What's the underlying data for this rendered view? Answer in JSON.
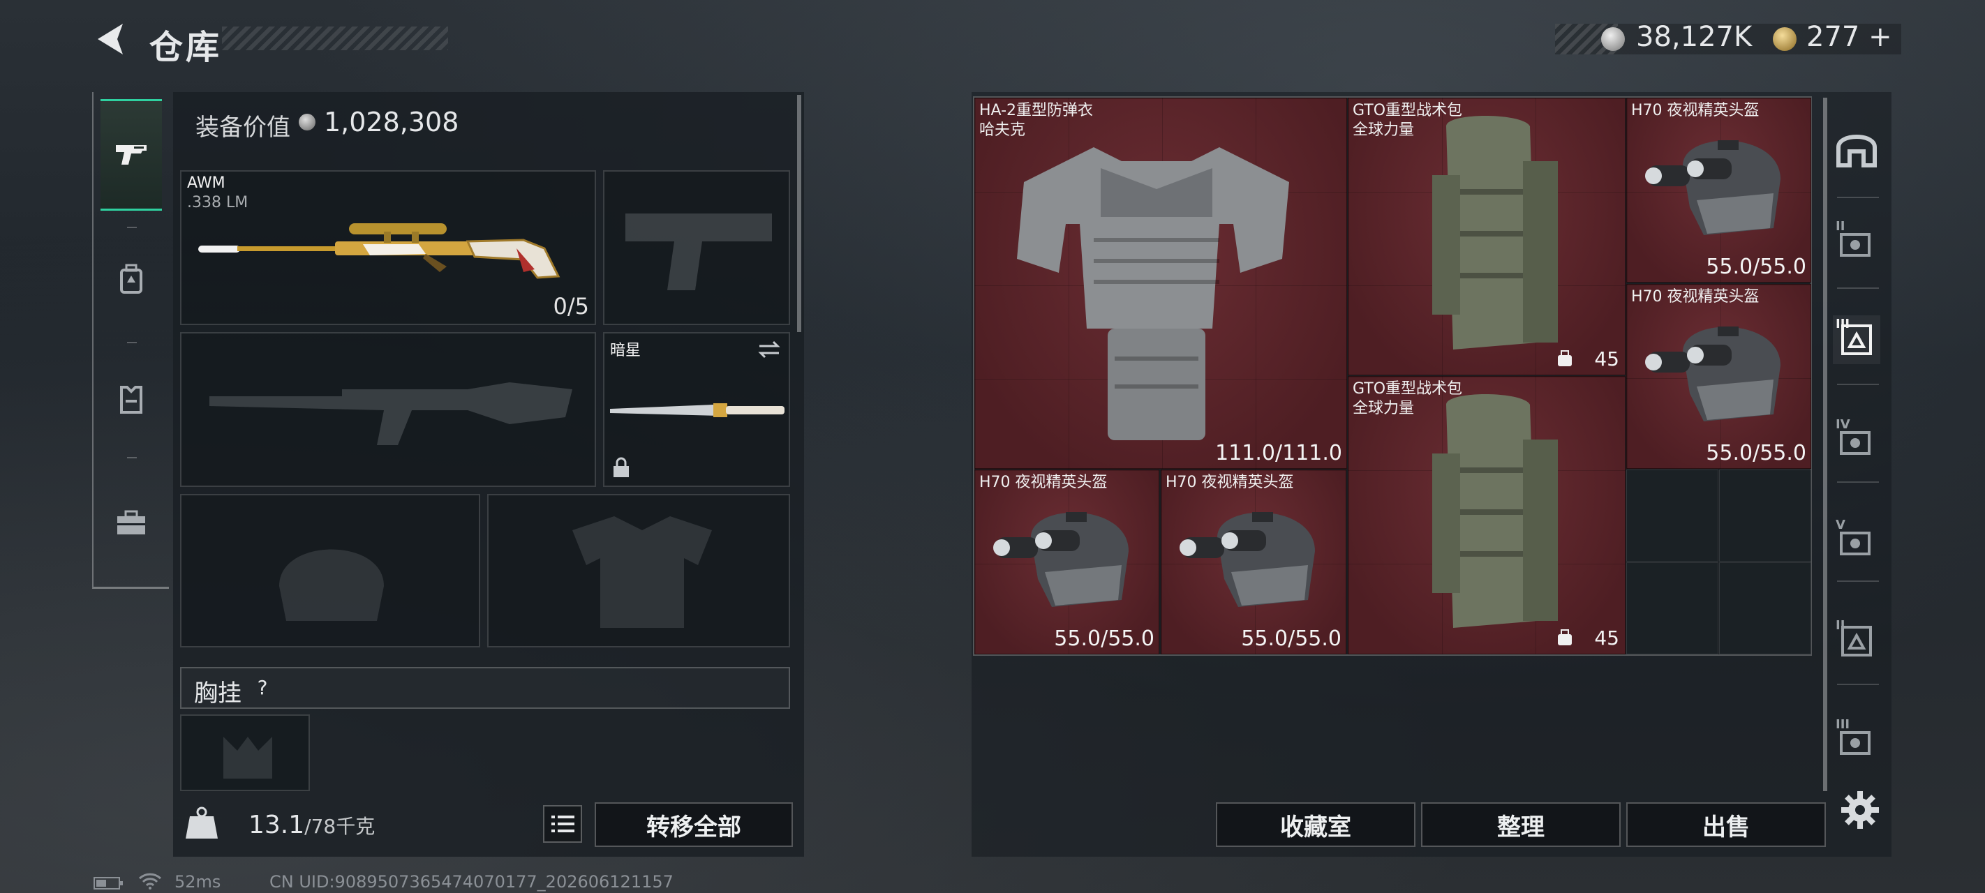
{
  "header": {
    "title": "仓库",
    "currency_1": "38,127K",
    "currency_2": "277",
    "currency_2_add": "+"
  },
  "equipment": {
    "value_label": "装备价值",
    "value": "1,028,308",
    "primary": {
      "name": "AWM",
      "ammo_type": ".338 LM",
      "ammo_count": "0/5"
    },
    "melee": {
      "name": "暗星"
    },
    "chest_rig_label": "胸挂",
    "chest_rig_help": "?"
  },
  "footer_left": {
    "weight_current": "13.1",
    "weight_max": "/78千克",
    "transfer_all": "转移全部"
  },
  "storage": {
    "items": [
      {
        "name": "HA-2重型防弹衣",
        "sub": "哈夫克",
        "value": "111.0/111.0"
      },
      {
        "name": "GTO重型战术包",
        "sub": "全球力量",
        "capacity": "45"
      },
      {
        "name": "H70 夜视精英头盔",
        "value": "55.0/55.0"
      },
      {
        "name": "H70 夜视精英头盔",
        "value": "55.0/55.0"
      },
      {
        "name": "GTO重型战术包",
        "sub": "全球力量",
        "capacity": "45"
      },
      {
        "name": "H70 夜视精英头盔",
        "value": "55.0/55.0"
      },
      {
        "name": "H70 夜视精英头盔",
        "value": "55.0/55.0"
      }
    ],
    "buttons": {
      "collection": "收藏室",
      "sort": "整理",
      "sell": "出售"
    }
  },
  "side_tabs": [
    "I",
    "II",
    "III",
    "IV",
    "V",
    "II",
    "III"
  ],
  "status": {
    "ping": "52ms",
    "uid": "CN UID:9089507365474070177_202606121157"
  },
  "icons": [
    "back-icon",
    "silver-coin-icon",
    "gold-coin-icon",
    "pistol-icon",
    "backpack-icon",
    "vest-icon",
    "toolbox-icon",
    "lock-icon",
    "swap-icon",
    "weight-icon",
    "list-icon",
    "gear-icon",
    "battery-icon",
    "wifi-icon"
  ],
  "colors": {
    "accent": "#2fd1a0",
    "item_cell": "#5a2228"
  }
}
